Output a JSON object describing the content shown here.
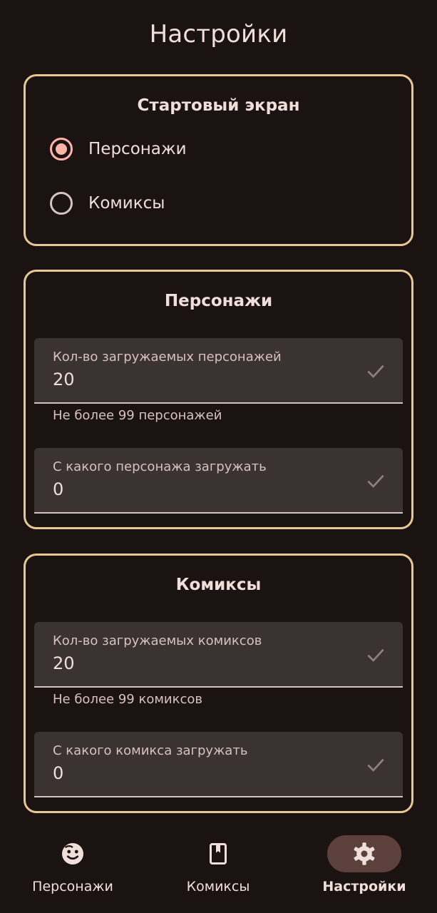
{
  "header": {
    "title": "Настройки"
  },
  "start_screen": {
    "title": "Стартовый экран",
    "options": [
      {
        "label": "Персонажи",
        "selected": true
      },
      {
        "label": "Комиксы",
        "selected": false
      }
    ]
  },
  "characters": {
    "title": "Персонажи",
    "count_field": {
      "label": "Кол-во загружаемых персонажей",
      "value": "20",
      "helper": "Не более 99 персонажей"
    },
    "offset_field": {
      "label": "С какого персонажа загружать",
      "value": "0"
    }
  },
  "comics": {
    "title": "Комиксы",
    "count_field": {
      "label": "Кол-во загружаемых комиксов",
      "value": "20",
      "helper": "Не более 99 комиксов"
    },
    "offset_field": {
      "label": "С какого комикса загружать",
      "value": "0"
    }
  },
  "bottom_nav": {
    "items": [
      {
        "label": "Персонажи",
        "icon": "face-icon",
        "active": false
      },
      {
        "label": "Комиксы",
        "icon": "book-icon",
        "active": false
      },
      {
        "label": "Настройки",
        "icon": "gear-icon",
        "active": true
      }
    ]
  },
  "colors": {
    "background": "#1b1212",
    "card_border": "#e7c793",
    "accent": "#ffb4a8",
    "field_fill": "#3b3232",
    "nav_active_pill": "#5c403c"
  }
}
